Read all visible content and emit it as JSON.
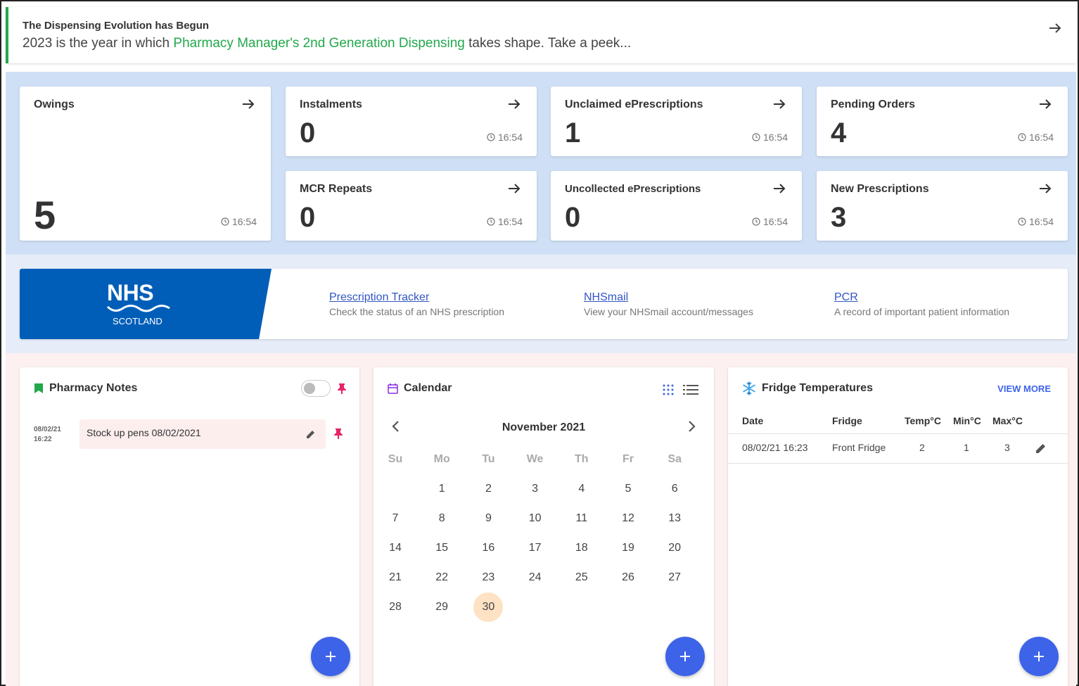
{
  "banner": {
    "title": "The Dispensing Evolution has Begun",
    "text_before": "2023 is the year in which ",
    "link_text": "Pharmacy Manager's 2nd Generation Dispensing",
    "text_after": " takes shape. Take a peek..."
  },
  "stats": {
    "owings": {
      "title": "Owings",
      "value": "5",
      "time": "16:54"
    },
    "instalments": {
      "title": "Instalments",
      "value": "0",
      "time": "16:54"
    },
    "unclaimed": {
      "title": "Unclaimed ePrescriptions",
      "value": "1",
      "time": "16:54"
    },
    "pending_orders": {
      "title": "Pending Orders",
      "value": "4",
      "time": "16:54"
    },
    "mcr_repeats": {
      "title": "MCR Repeats",
      "value": "0",
      "time": "16:54"
    },
    "uncollected": {
      "title": "Uncollected ePrescriptions",
      "value": "0",
      "time": "16:54"
    },
    "new_prescriptions": {
      "title": "New Prescriptions",
      "value": "3",
      "time": "16:54"
    }
  },
  "nhs": {
    "logo_top": "NHS",
    "logo_bottom": "SCOTLAND",
    "links": [
      {
        "label": "Prescription Tracker",
        "desc": "Check the status of an NHS prescription"
      },
      {
        "label": "NHSmail",
        "desc": "View your NHSmail account/messages"
      },
      {
        "label": "PCR",
        "desc": "A record of important patient information"
      }
    ]
  },
  "notes": {
    "title": "Pharmacy Notes",
    "items": [
      {
        "date": "08/02/21\n16:22",
        "text": "Stock up pens 08/02/2021"
      }
    ]
  },
  "calendar": {
    "title": "Calendar",
    "month": "November 2021",
    "weekdays": [
      "Su",
      "Mo",
      "Tu",
      "We",
      "Th",
      "Fr",
      "Sa"
    ],
    "first_weekday_index": 1,
    "days_in_month": 30,
    "today": 30
  },
  "fridge": {
    "title": "Fridge Temperatures",
    "view_more": "VIEW MORE",
    "headers": [
      "Date",
      "Fridge",
      "Temp°C",
      "Min°C",
      "Max°C"
    ],
    "rows": [
      {
        "date": "08/02/21 16:23",
        "fridge": "Front Fridge",
        "temp": "2",
        "min": "1",
        "max": "3"
      }
    ]
  },
  "colors": {
    "accent_green": "#22a84b",
    "nhs_blue": "#005eb8",
    "fab_blue": "#3d63e8",
    "pin_pink": "#e8246a",
    "today_highlight": "#fde2c3"
  },
  "icons": [
    "arrow-right-icon",
    "clock-icon",
    "bookmark-icon",
    "pin-icon",
    "pencil-icon",
    "calendar-icon",
    "grid-icon",
    "list-icon",
    "chevron-left-icon",
    "chevron-right-icon",
    "snowflake-icon",
    "plus-icon"
  ]
}
